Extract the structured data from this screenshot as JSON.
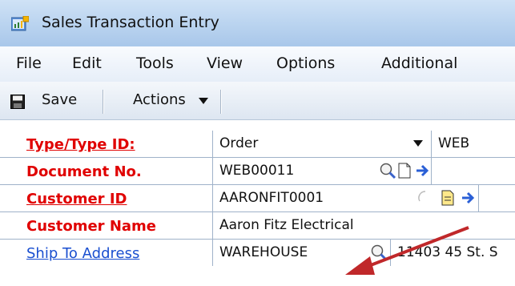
{
  "window": {
    "title": "Sales Transaction Entry"
  },
  "menu": {
    "items": [
      "File",
      "Edit",
      "Tools",
      "View",
      "Options",
      "Additional"
    ]
  },
  "toolbar": {
    "save_label": "Save",
    "actions_label": "Actions"
  },
  "form": {
    "type_id": {
      "label": "Type/Type ID:",
      "type_value": "Order",
      "id_value": "WEB"
    },
    "document_no": {
      "label": "Document No.",
      "value": "WEB00011"
    },
    "customer_id": {
      "label": "Customer ID",
      "value": "AARONFIT0001"
    },
    "customer_name": {
      "label": "Customer Name",
      "value": "Aaron Fitz Electrical"
    },
    "ship_to": {
      "label": "Ship To Address",
      "value": "WAREHOUSE",
      "address": "11403 45 St. S"
    }
  },
  "colors": {
    "required_label": "#e00000",
    "link_label": "#1a4fd0",
    "annotation_arrow": "#c0282a"
  },
  "icons": [
    "app-icon",
    "save-icon",
    "dropdown-arrow-icon",
    "lookup-icon",
    "note-icon",
    "expand-arrow-icon",
    "spinner-icon"
  ]
}
